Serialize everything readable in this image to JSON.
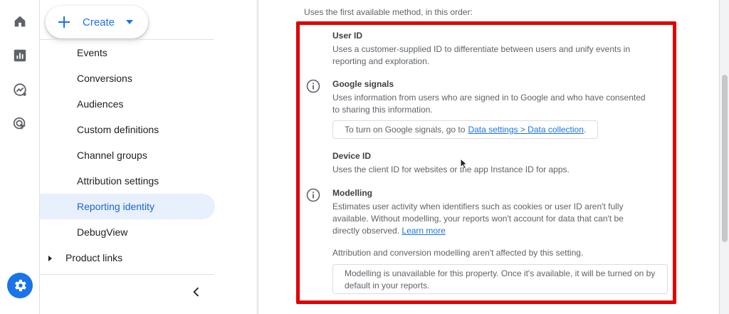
{
  "rail": {
    "icons": [
      "home-icon",
      "reports-icon",
      "explore-icon",
      "advertising-icon"
    ],
    "settings_icon": "gear-icon",
    "accent": "#1a73e8"
  },
  "nav": {
    "create_label": "Create",
    "items": [
      {
        "label": "Events",
        "active": false
      },
      {
        "label": "Conversions",
        "active": false
      },
      {
        "label": "Audiences",
        "active": false
      },
      {
        "label": "Custom definitions",
        "active": false
      },
      {
        "label": "Channel groups",
        "active": false
      },
      {
        "label": "Attribution settings",
        "active": false
      },
      {
        "label": "Reporting identity",
        "active": true
      },
      {
        "label": "DebugView",
        "active": false
      }
    ],
    "product_links_label": "Product links",
    "collapse_icon": "chevron-left-icon"
  },
  "main": {
    "intro": "Uses the first available method, in this order:",
    "highlight_color": "#e00000",
    "methods": {
      "user_id": {
        "title": "User ID",
        "desc": "Uses a customer-supplied ID to differentiate between users and unify events in reporting and exploration."
      },
      "google_signals": {
        "title": "Google signals",
        "desc": "Uses information from users who are signed in to Google and who have consented to sharing this information.",
        "notice_text": "To turn on Google signals, go to",
        "notice_link": "Data settings > Data collection",
        "notice_suffix": "."
      },
      "device_id": {
        "title": "Device ID",
        "desc": "Uses the client ID for websites or the app Instance ID for apps."
      },
      "modelling": {
        "title": "Modelling",
        "desc": "Estimates user activity when identifiers such as cookies or user ID aren't fully available. Without modelling, your reports won't account for data that can't be directly observed.",
        "learn_more": "Learn more",
        "attribution_note": "Attribution and conversion modelling aren't affected by this setting.",
        "unavailable_notice": "Modelling is unavailable for this property. Once it's available, it will be turned on by default in your reports."
      }
    }
  }
}
